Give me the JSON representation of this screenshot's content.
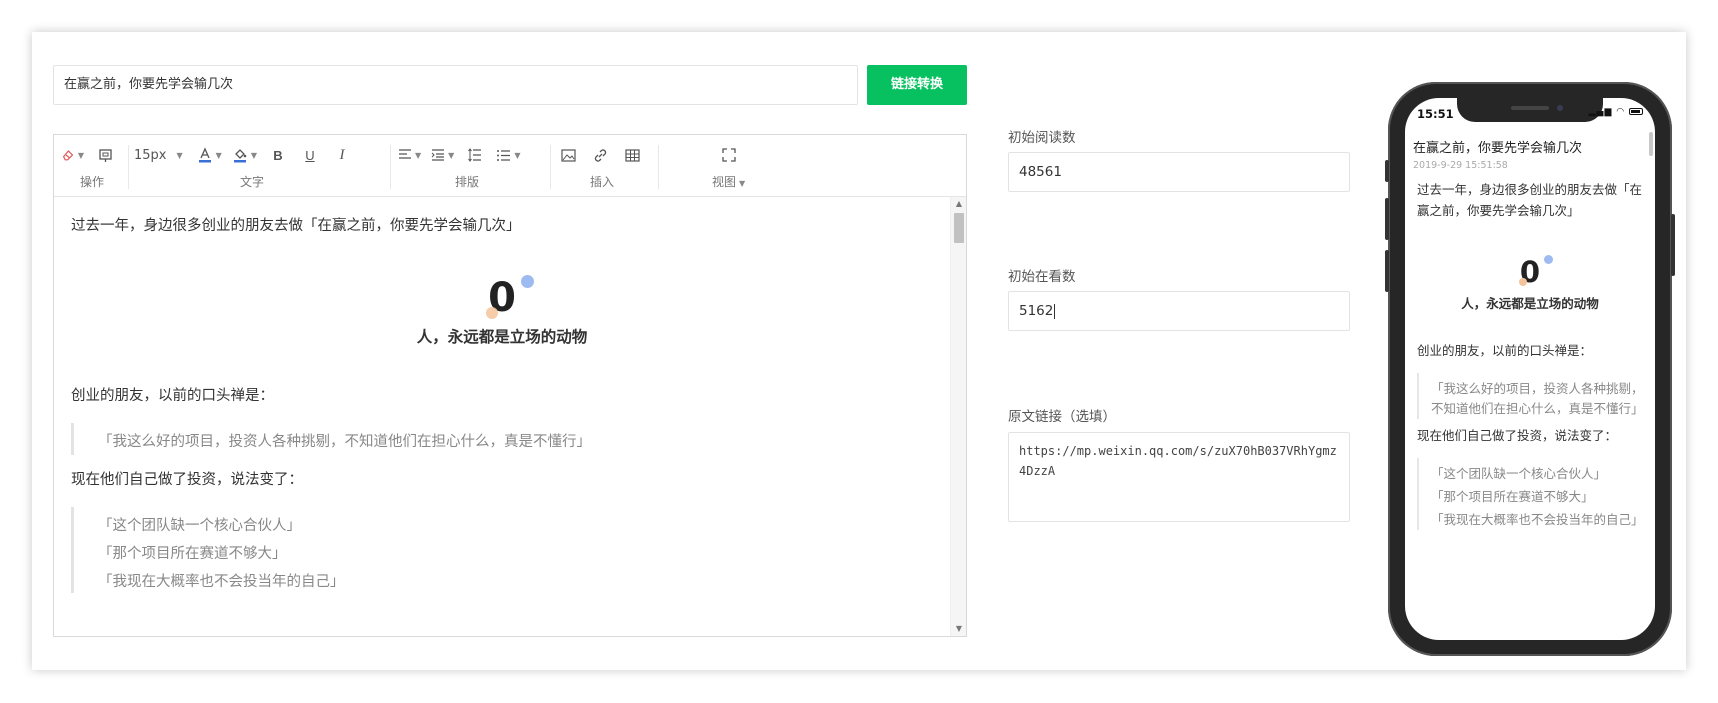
{
  "header": {
    "title_value": "在赢之前，你要先学会输几次",
    "convert_label": "链接转换"
  },
  "toolbar": {
    "font_size": "15px",
    "groups": {
      "operate": "操作",
      "text": "文字",
      "layout": "排版",
      "insert": "插入",
      "view": "视图"
    },
    "bold": "B",
    "underline": "U",
    "italic": "I"
  },
  "editor": {
    "p1": "过去一年，身边很多创业的朋友去做「在赢之前，你要先学会输几次」",
    "big_number": "0",
    "subtitle": "人，永远都是立场的动物",
    "p2": "创业的朋友，以前的口头禅是：",
    "quote1": "「我这么好的项目，投资人各种挑剔，不知道他们在担心什么，真是不懂行」",
    "p3": "现在他们自己做了投资，说法变了：",
    "quote2_lines": [
      "「这个团队缺一个核心合伙人」",
      "「那个项目所在赛道不够大」",
      "「我现在大概率也不会投当年的自己」"
    ]
  },
  "form": {
    "read_label": "初始阅读数",
    "read_value": "48561",
    "watch_label": "初始在看数",
    "watch_value": "5162",
    "link_label": "原文链接（选填）",
    "link_value": "https://mp.weixin.qq.com/s/zuX70hB037VRhYgmz4DzzA"
  },
  "phone": {
    "time": "15:51",
    "title": "在赢之前，你要先学会输几次",
    "date": "2019-9-29 15:51:58",
    "p1": "过去一年，身边很多创业的朋友去做「在赢之前，你要先学会输几次」",
    "big_number": "0",
    "subtitle": "人，永远都是立场的动物",
    "p2": "创业的朋友，以前的口头禅是：",
    "quote1": "「我这么好的项目，投资人各种挑剔，不知道他们在担心什么，真是不懂行」",
    "p3": "现在他们自己做了投资，说法变了：",
    "quote2_lines": [
      "「这个团队缺一个核心合伙人」",
      "「那个项目所在赛道不够大」",
      "「我现在大概率也不会投当年的自己」"
    ]
  },
  "colors": {
    "primary_green": "#07c160",
    "phone_frame": "#262626"
  }
}
